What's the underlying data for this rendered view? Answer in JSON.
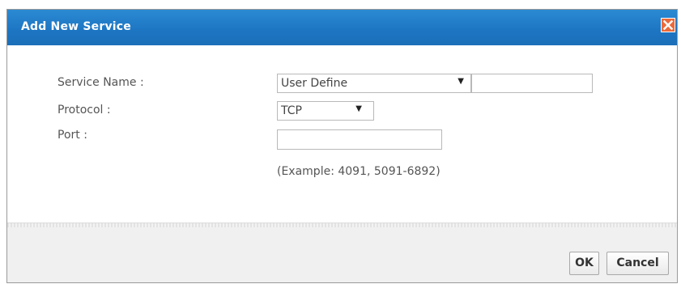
{
  "dialog": {
    "title": "Add New Service",
    "close_icon": "close-icon"
  },
  "form": {
    "service_name": {
      "label": "Service Name :",
      "selected": "User Define",
      "custom_value": ""
    },
    "protocol": {
      "label": "Protocol :",
      "selected": "TCP"
    },
    "port": {
      "label": "Port :",
      "value": "",
      "example": "(Example: 4091, 5091-6892)"
    }
  },
  "buttons": {
    "ok_label": "OK",
    "cancel_label": "Cancel"
  },
  "colors": {
    "title_bar": "#1d75c2",
    "close_button": "#ec6a3a",
    "footer": "#f0f0f0"
  }
}
